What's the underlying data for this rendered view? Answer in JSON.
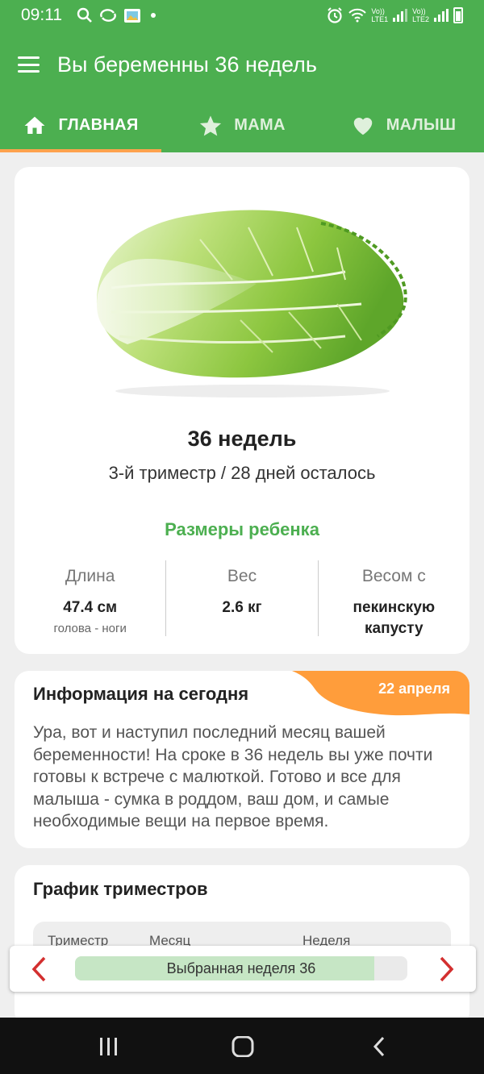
{
  "status_bar": {
    "time": "09:11",
    "sim1": [
      "Vo))",
      "LTE1"
    ],
    "sim2": [
      "Vo))",
      "LTE2"
    ]
  },
  "app_bar": {
    "title": "Вы беременны 36 недель"
  },
  "tabs": [
    {
      "label": "ГЛАВНАЯ",
      "icon": "home-icon",
      "active": true
    },
    {
      "label": "МАМА",
      "icon": "star-icon"
    },
    {
      "label": "МАЛЫШ",
      "icon": "heart-icon"
    }
  ],
  "main_card": {
    "image": "napa-cabbage",
    "week_title": "36 недель",
    "trimester_text": "3-й триместр / 28 дней осталось",
    "sizes_title": "Размеры ребенка",
    "stats": [
      {
        "label": "Длина",
        "value": "47.4 см",
        "sub": "голова - ноги"
      },
      {
        "label": "Вес",
        "value": "2.6 кг",
        "sub": ""
      },
      {
        "label": "Весом с",
        "value": "пекинскую капусту",
        "sub": ""
      }
    ]
  },
  "info_card": {
    "title": "Информация на сегодня",
    "date": "22 апреля",
    "body": "Ура, вот и наступил последний месяц вашей беременности! На сроке в 36 недель вы уже почти готовы к встрече с малюткой. Готово и все для малыша - сумка в роддом, ваш дом, и самые необходимые вещи на первое время."
  },
  "chart_card": {
    "title": "График триместров",
    "headers": [
      "Триместр",
      "Месяц",
      "Неделя"
    ]
  },
  "week_selector": {
    "label": "Выбранная неделя 36",
    "progress": 0.9
  },
  "colors": {
    "primary": "#4caf50",
    "accent": "#ffa24d",
    "arrow": "#d32f2f"
  }
}
